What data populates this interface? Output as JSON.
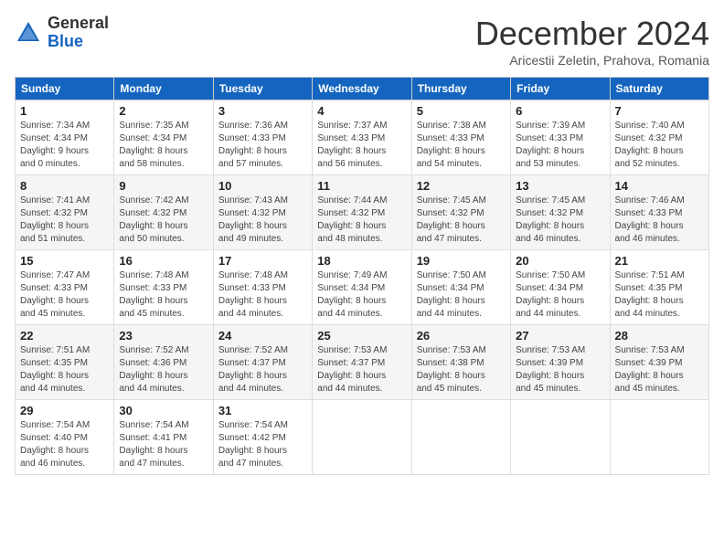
{
  "header": {
    "logo_general": "General",
    "logo_blue": "Blue",
    "month_title": "December 2024",
    "subtitle": "Aricestii Zeletin, Prahova, Romania"
  },
  "days_of_week": [
    "Sunday",
    "Monday",
    "Tuesday",
    "Wednesday",
    "Thursday",
    "Friday",
    "Saturday"
  ],
  "weeks": [
    [
      {
        "day": "1",
        "info": "Sunrise: 7:34 AM\nSunset: 4:34 PM\nDaylight: 9 hours\nand 0 minutes."
      },
      {
        "day": "2",
        "info": "Sunrise: 7:35 AM\nSunset: 4:34 PM\nDaylight: 8 hours\nand 58 minutes."
      },
      {
        "day": "3",
        "info": "Sunrise: 7:36 AM\nSunset: 4:33 PM\nDaylight: 8 hours\nand 57 minutes."
      },
      {
        "day": "4",
        "info": "Sunrise: 7:37 AM\nSunset: 4:33 PM\nDaylight: 8 hours\nand 56 minutes."
      },
      {
        "day": "5",
        "info": "Sunrise: 7:38 AM\nSunset: 4:33 PM\nDaylight: 8 hours\nand 54 minutes."
      },
      {
        "day": "6",
        "info": "Sunrise: 7:39 AM\nSunset: 4:33 PM\nDaylight: 8 hours\nand 53 minutes."
      },
      {
        "day": "7",
        "info": "Sunrise: 7:40 AM\nSunset: 4:32 PM\nDaylight: 8 hours\nand 52 minutes."
      }
    ],
    [
      {
        "day": "8",
        "info": "Sunrise: 7:41 AM\nSunset: 4:32 PM\nDaylight: 8 hours\nand 51 minutes."
      },
      {
        "day": "9",
        "info": "Sunrise: 7:42 AM\nSunset: 4:32 PM\nDaylight: 8 hours\nand 50 minutes."
      },
      {
        "day": "10",
        "info": "Sunrise: 7:43 AM\nSunset: 4:32 PM\nDaylight: 8 hours\nand 49 minutes."
      },
      {
        "day": "11",
        "info": "Sunrise: 7:44 AM\nSunset: 4:32 PM\nDaylight: 8 hours\nand 48 minutes."
      },
      {
        "day": "12",
        "info": "Sunrise: 7:45 AM\nSunset: 4:32 PM\nDaylight: 8 hours\nand 47 minutes."
      },
      {
        "day": "13",
        "info": "Sunrise: 7:45 AM\nSunset: 4:32 PM\nDaylight: 8 hours\nand 46 minutes."
      },
      {
        "day": "14",
        "info": "Sunrise: 7:46 AM\nSunset: 4:33 PM\nDaylight: 8 hours\nand 46 minutes."
      }
    ],
    [
      {
        "day": "15",
        "info": "Sunrise: 7:47 AM\nSunset: 4:33 PM\nDaylight: 8 hours\nand 45 minutes."
      },
      {
        "day": "16",
        "info": "Sunrise: 7:48 AM\nSunset: 4:33 PM\nDaylight: 8 hours\nand 45 minutes."
      },
      {
        "day": "17",
        "info": "Sunrise: 7:48 AM\nSunset: 4:33 PM\nDaylight: 8 hours\nand 44 minutes."
      },
      {
        "day": "18",
        "info": "Sunrise: 7:49 AM\nSunset: 4:34 PM\nDaylight: 8 hours\nand 44 minutes."
      },
      {
        "day": "19",
        "info": "Sunrise: 7:50 AM\nSunset: 4:34 PM\nDaylight: 8 hours\nand 44 minutes."
      },
      {
        "day": "20",
        "info": "Sunrise: 7:50 AM\nSunset: 4:34 PM\nDaylight: 8 hours\nand 44 minutes."
      },
      {
        "day": "21",
        "info": "Sunrise: 7:51 AM\nSunset: 4:35 PM\nDaylight: 8 hours\nand 44 minutes."
      }
    ],
    [
      {
        "day": "22",
        "info": "Sunrise: 7:51 AM\nSunset: 4:35 PM\nDaylight: 8 hours\nand 44 minutes."
      },
      {
        "day": "23",
        "info": "Sunrise: 7:52 AM\nSunset: 4:36 PM\nDaylight: 8 hours\nand 44 minutes."
      },
      {
        "day": "24",
        "info": "Sunrise: 7:52 AM\nSunset: 4:37 PM\nDaylight: 8 hours\nand 44 minutes."
      },
      {
        "day": "25",
        "info": "Sunrise: 7:53 AM\nSunset: 4:37 PM\nDaylight: 8 hours\nand 44 minutes."
      },
      {
        "day": "26",
        "info": "Sunrise: 7:53 AM\nSunset: 4:38 PM\nDaylight: 8 hours\nand 45 minutes."
      },
      {
        "day": "27",
        "info": "Sunrise: 7:53 AM\nSunset: 4:39 PM\nDaylight: 8 hours\nand 45 minutes."
      },
      {
        "day": "28",
        "info": "Sunrise: 7:53 AM\nSunset: 4:39 PM\nDaylight: 8 hours\nand 45 minutes."
      }
    ],
    [
      {
        "day": "29",
        "info": "Sunrise: 7:54 AM\nSunset: 4:40 PM\nDaylight: 8 hours\nand 46 minutes."
      },
      {
        "day": "30",
        "info": "Sunrise: 7:54 AM\nSunset: 4:41 PM\nDaylight: 8 hours\nand 47 minutes."
      },
      {
        "day": "31",
        "info": "Sunrise: 7:54 AM\nSunset: 4:42 PM\nDaylight: 8 hours\nand 47 minutes."
      },
      null,
      null,
      null,
      null
    ]
  ]
}
